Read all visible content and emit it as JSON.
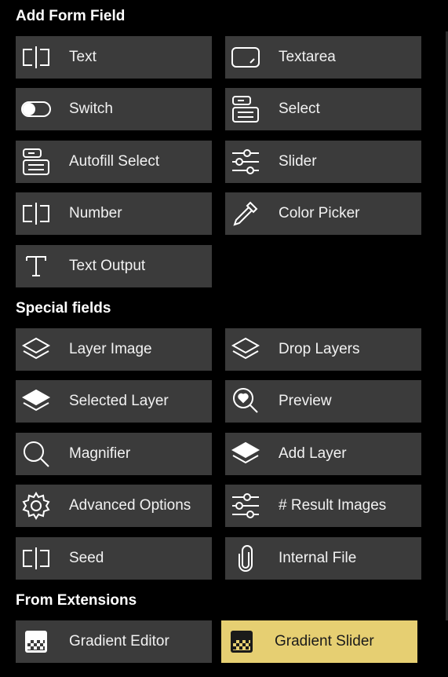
{
  "sections": {
    "form": "Add Form Field",
    "special": "Special fields",
    "extensions": "From Extensions"
  },
  "buttons": {
    "text": "Text",
    "textarea": "Textarea",
    "switch": "Switch",
    "select": "Select",
    "autofill_select": "Autofill Select",
    "slider": "Slider",
    "number": "Number",
    "color_picker": "Color Picker",
    "text_output": "Text Output",
    "layer_image": "Layer Image",
    "drop_layers": "Drop Layers",
    "selected_layer": "Selected Layer",
    "preview": "Preview",
    "magnifier": "Magnifier",
    "add_layer": "Add Layer",
    "advanced_options": "Advanced Options",
    "result_images": "# Result Images",
    "seed": "Seed",
    "internal_file": "Internal File",
    "gradient_editor": "Gradient Editor",
    "gradient_slider": "Gradient Slider"
  },
  "colors": {
    "background": "#000000",
    "button": "#3b3b3b",
    "highlight": "#e6cf72"
  }
}
